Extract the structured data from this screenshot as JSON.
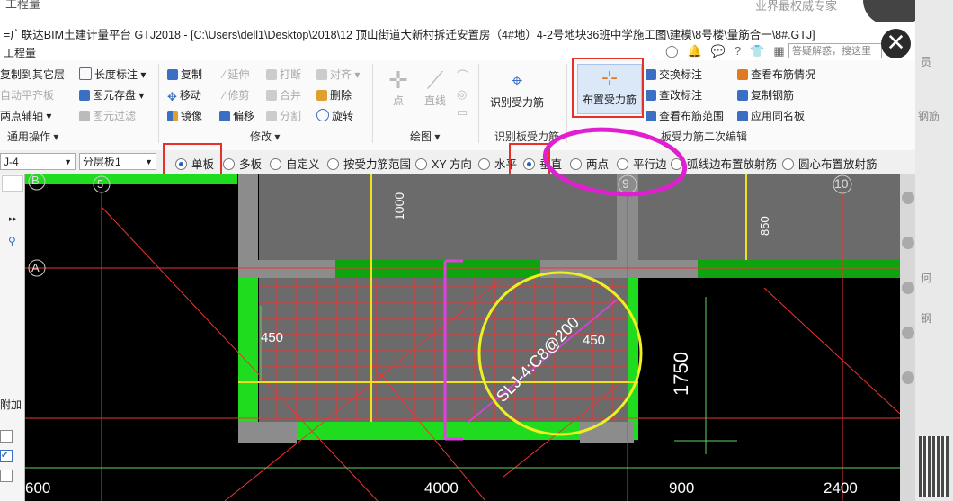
{
  "background": {
    "top_text": "工程量",
    "top_right_text": "业界最权威专家",
    "right_texts": [
      "员",
      "钢筋",
      "何",
      "钢"
    ]
  },
  "window": {
    "title": "=广联达BIM土建计量平台 GTJ2018 - [C:\\Users\\dell1\\Desktop\\2018\\12 顶山街道大新村拆迁安置房（4#地）4-2号地块36班中学施工图\\建模\\8号楼\\量筋合一\\8#.GTJ]",
    "menu_label": "工程量",
    "search_placeholder": "答疑解惑，搜这里",
    "close_symbol": "✕"
  },
  "ribbon": {
    "general": {
      "items": [
        "复制到其它层",
        "自动平齐板",
        "两点辅轴",
        "长度标注",
        "图元存盘",
        "图元过滤"
      ],
      "group": "通用操作"
    },
    "modify": {
      "items": [
        "复制",
        "延伸",
        "打断",
        "对齐",
        "移动",
        "修剪",
        "合并",
        "删除",
        "镜像",
        "偏移",
        "分割",
        "旋转"
      ],
      "group": "修改"
    },
    "draw": {
      "items": [
        "点",
        "直线"
      ],
      "group": "绘图"
    },
    "identify": {
      "item": "识别受力筋",
      "group": "识别板受力筋"
    },
    "secondary": {
      "big_button": "布置受力筋",
      "items": [
        "交换标注",
        "查看布筋情况",
        "查改标注",
        "复制钢筋",
        "查看布筋范围",
        "应用同名板"
      ],
      "group": "板受力筋二次编辑"
    }
  },
  "options": {
    "combo1": "J-4",
    "combo2": "分层板1",
    "radios": [
      {
        "label": "单板",
        "checked": true
      },
      {
        "label": "多板",
        "checked": false
      },
      {
        "label": "自定义",
        "checked": false
      },
      {
        "label": "按受力筋范围",
        "checked": false
      },
      {
        "label": "XY 方向",
        "checked": false
      },
      {
        "label": "水平",
        "checked": false
      },
      {
        "label": "垂直",
        "checked": true
      },
      {
        "label": "两点",
        "checked": false
      },
      {
        "label": "平行边",
        "checked": false
      },
      {
        "label": "弧线边布置放射筋",
        "checked": false
      },
      {
        "label": "圆心布置放射筋",
        "checked": false
      }
    ]
  },
  "left_panel": {
    "axis_b": "B",
    "axis_a": "A",
    "add_label": "附加"
  },
  "drawing": {
    "axis_5": "5",
    "axis_9": "9",
    "axis_10": "10",
    "dim_1000": "1000",
    "dim_850": "850",
    "dim_450_left": "450",
    "dim_450_right": "450",
    "dim_1750": "1750",
    "rebar_label": "SLJ-4:C8@200",
    "bottom_dims": [
      "600",
      "4000",
      "900",
      "2400"
    ]
  }
}
